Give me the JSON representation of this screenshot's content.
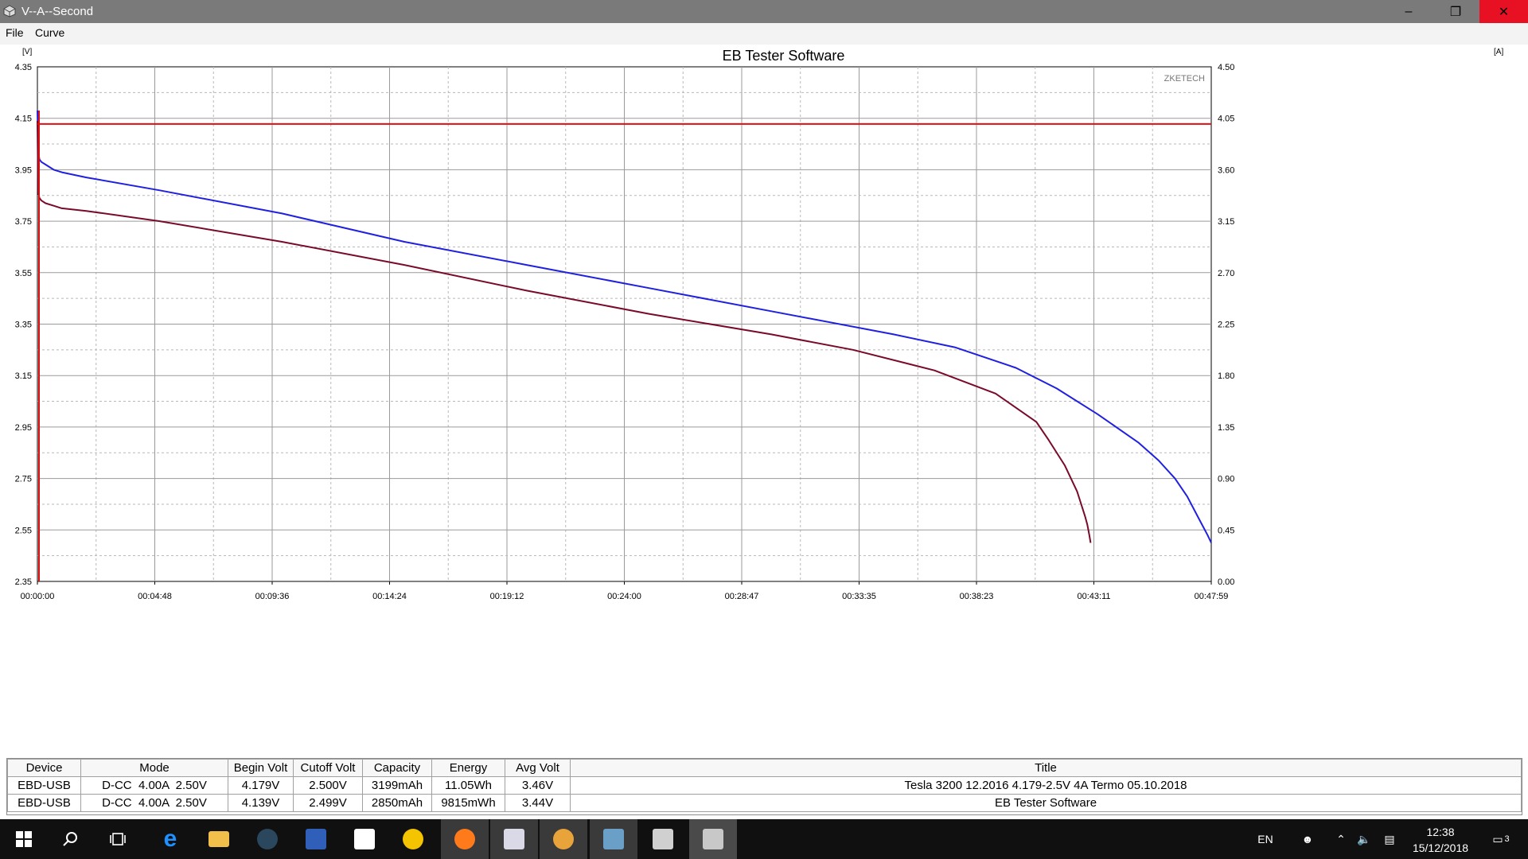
{
  "window": {
    "title": "V--A--Second",
    "min_label": "–",
    "max_label": "❐",
    "close_label": "✕"
  },
  "menu": {
    "items": [
      "File",
      "Curve"
    ]
  },
  "chart_data": {
    "type": "line",
    "title": "EB Tester Software",
    "watermark": "ZKETECH",
    "left_unit": "[V]",
    "right_unit": "[A]",
    "x_ticks": [
      "00:00:00",
      "00:04:48",
      "00:09:36",
      "00:14:24",
      "00:19:12",
      "00:24:00",
      "00:28:47",
      "00:33:35",
      "00:38:23",
      "00:43:11",
      "00:47:59"
    ],
    "y_left_ticks": [
      "2.35",
      "2.55",
      "2.75",
      "2.95",
      "3.15",
      "3.35",
      "3.55",
      "3.75",
      "3.95",
      "4.15",
      "4.35"
    ],
    "y_right_ticks": [
      "0.00",
      "0.45",
      "0.90",
      "1.35",
      "1.80",
      "2.25",
      "2.70",
      "3.15",
      "3.60",
      "4.05",
      "4.50"
    ],
    "xlim_seconds": [
      0,
      2879
    ],
    "ylim_left": [
      2.35,
      4.35
    ],
    "ylim_right": [
      0,
      4.5
    ],
    "grid": true,
    "series": [
      {
        "color": "#2020e0",
        "axis": "left",
        "x": [
          0,
          2,
          5,
          10,
          20,
          40,
          60,
          120,
          300,
          600,
          900,
          1200,
          1500,
          1800,
          2100,
          2250,
          2400,
          2500,
          2600,
          2700,
          2750,
          2790,
          2820,
          2850,
          2870,
          2879
        ],
        "y": [
          4.18,
          4.02,
          3.99,
          3.98,
          3.97,
          3.95,
          3.94,
          3.92,
          3.87,
          3.78,
          3.67,
          3.58,
          3.49,
          3.4,
          3.31,
          3.26,
          3.18,
          3.1,
          3.0,
          2.89,
          2.82,
          2.75,
          2.68,
          2.59,
          2.53,
          2.5
        ]
      },
      {
        "color": "#7a0a2a",
        "axis": "left",
        "x": [
          0,
          2,
          5,
          10,
          20,
          40,
          60,
          120,
          300,
          600,
          900,
          1200,
          1500,
          1800,
          2000,
          2200,
          2350,
          2450,
          2480,
          2520,
          2550,
          2560,
          2570,
          2575,
          2580,
          2583
        ],
        "y": [
          4.14,
          3.86,
          3.84,
          3.83,
          3.82,
          3.81,
          3.8,
          3.79,
          3.75,
          3.67,
          3.58,
          3.48,
          3.39,
          3.31,
          3.25,
          3.17,
          3.08,
          2.97,
          2.9,
          2.8,
          2.7,
          2.65,
          2.6,
          2.57,
          2.53,
          2.5
        ]
      },
      {
        "color": "#e01010",
        "axis": "right",
        "x": [
          0,
          2879
        ],
        "y": [
          4.0,
          4.0
        ]
      }
    ]
  },
  "table": {
    "headers": [
      "Device",
      "Mode",
      "Begin Volt",
      "Cutoff Volt",
      "Capacity",
      "Energy",
      "Avg Volt",
      "Title"
    ],
    "rows": [
      [
        "EBD-USB",
        "D-CC  4.00A  2.50V",
        "4.179V",
        "2.500V",
        "3199mAh",
        "11.05Wh",
        "3.46V",
        "Tesla 3200 12.2016 4.179-2.5V 4A Termo 05.10.2018"
      ],
      [
        "EBD-USB",
        "D-CC  4.00A  2.50V",
        "4.139V",
        "2.499V",
        "2850mAh",
        "9815mWh",
        "3.44V",
        "EB Tester Software"
      ]
    ]
  },
  "taskbar": {
    "language": "EN",
    "time": "12:38",
    "date": "15/12/2018",
    "notification_count": "3",
    "icons": [
      "start-icon",
      "search-icon",
      "task-view-icon",
      "edge-icon",
      "file-explorer-icon",
      "steam-icon",
      "save-disk-icon",
      "store-icon",
      "batman-icon",
      "firefox-icon",
      "editor-icon",
      "chrome-icon",
      "image-viewer-icon",
      "calculator-icon",
      "eb-tester-icon"
    ]
  }
}
